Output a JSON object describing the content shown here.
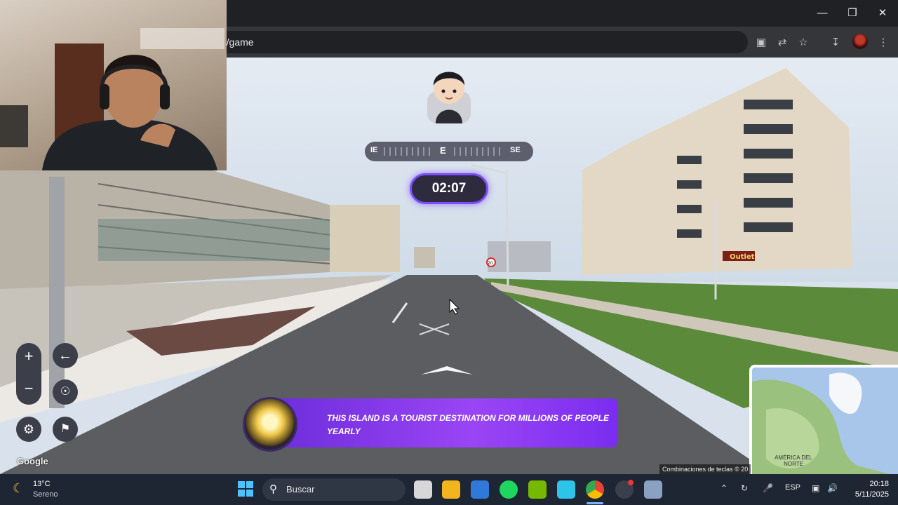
{
  "browser": {
    "url_fragment": "r/game",
    "window_controls": [
      "minimize-icon",
      "restore-icon",
      "close-icon"
    ],
    "toolbar_icons": [
      "install-icon",
      "translate-icon",
      "star-icon",
      "download-icon",
      "profile-icon",
      "menu-icon"
    ]
  },
  "game": {
    "compass": {
      "left": "IE",
      "center": "E",
      "right": "SE"
    },
    "timer": "02:07",
    "hint": "This island is a tourist destination for millions of people yearly",
    "controls": [
      "zoom-in-icon",
      "zoom-out-icon",
      "undo-icon",
      "location-pin-icon",
      "settings-icon",
      "flag-icon"
    ]
  },
  "streetview": {
    "google_logo": "Google",
    "shop_sign": "Outlet",
    "speed_sign": "20"
  },
  "minimap": {
    "label": "AMÉRICA DEL NORTE",
    "attribution": "Combinaciones de teclas",
    "attribution_tail": "© 20"
  },
  "taskbar": {
    "weather": {
      "temp": "13°C",
      "desc": "Sereno"
    },
    "search_placeholder": "Buscar",
    "language": "ESP",
    "time": "20:18",
    "date": "5/11/2025"
  },
  "colors": {
    "accent": "#7b4dff",
    "hint_bar": "#9a45f5",
    "taskbar": "#1f2633"
  }
}
